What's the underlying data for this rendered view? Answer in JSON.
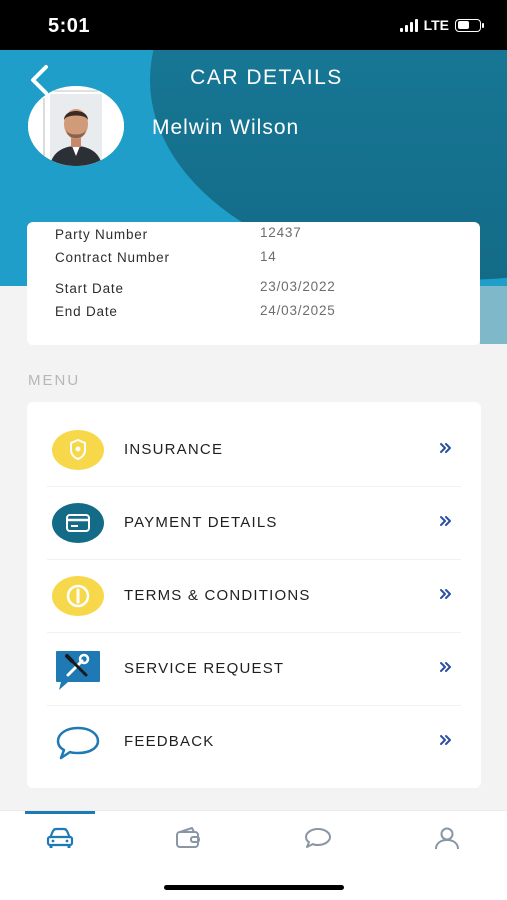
{
  "status_bar": {
    "time": "5:01",
    "network": "LTE"
  },
  "header": {
    "title": "CAR DETAILS",
    "user_name": "Melwin Wilson"
  },
  "details": {
    "party_number_label": "Party Number",
    "party_number": "12437",
    "contract_number_label": "Contract Number",
    "contract_number": "14",
    "start_date_label": "Start Date",
    "start_date": "23/03/2022",
    "end_date_label": "End Date",
    "end_date": "24/03/2025"
  },
  "menu": {
    "heading": "MENU",
    "items": [
      {
        "label": "INSURANCE",
        "icon": "insurance-shield-icon"
      },
      {
        "label": "PAYMENT DETAILS",
        "icon": "wallet-card-icon"
      },
      {
        "label": "TERMS & CONDITIONS",
        "icon": "info-circle-icon"
      },
      {
        "label": "SERVICE REQUEST",
        "icon": "wrench-screwdriver-icon"
      },
      {
        "label": "FEEDBACK",
        "icon": "chat-bubble-icon"
      }
    ]
  },
  "tabs": [
    "car-icon",
    "wallet-icon",
    "chat-icon",
    "profile-icon"
  ],
  "colors": {
    "primary": "#1e9ec8",
    "dark_teal": "#136b87",
    "accent_yellow": "#f7d84a",
    "accent_blue": "#1f79b5"
  }
}
